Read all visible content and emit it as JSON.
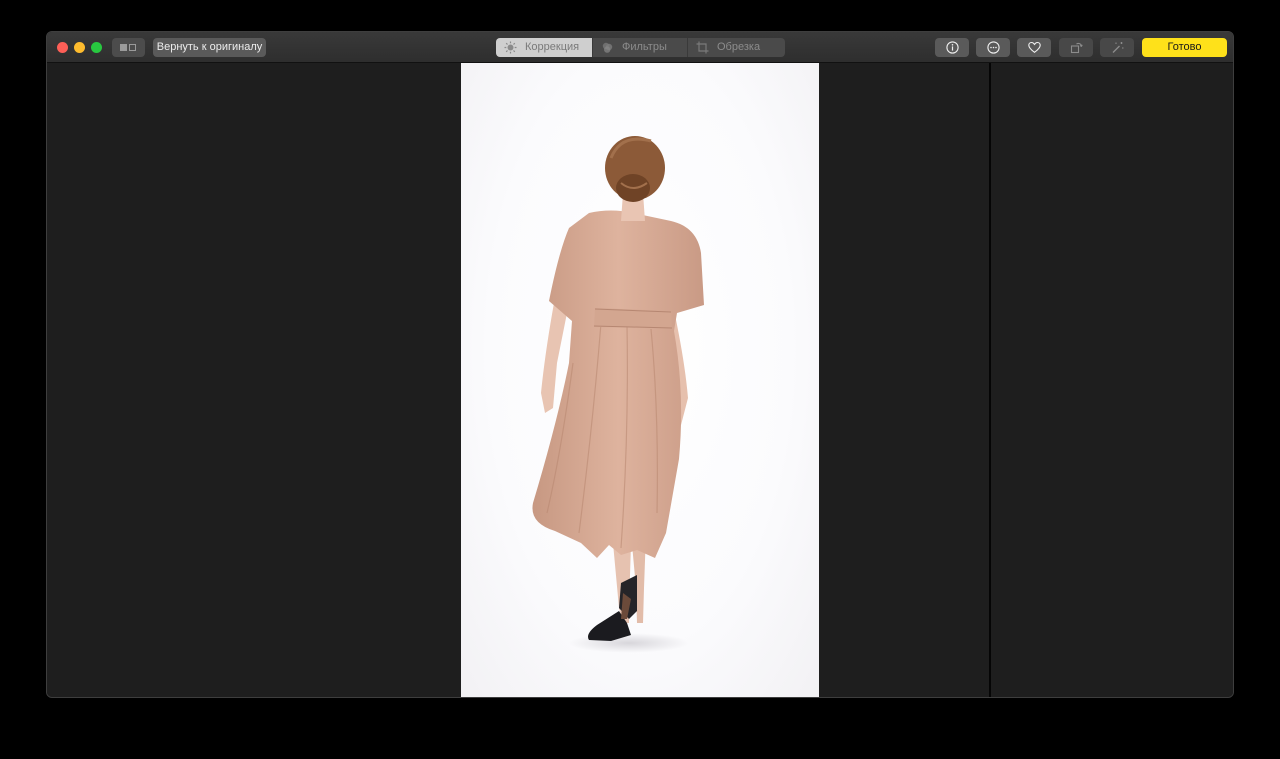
{
  "window": {
    "traffic_lights": [
      "close",
      "minimize",
      "zoom"
    ]
  },
  "toolbar": {
    "view_toggle_icon": "split-view-icon",
    "revert_label": "Вернуть к оригиналу",
    "tabs": [
      {
        "label": "Коррекция",
        "icon": "adjust-icon",
        "active": true
      },
      {
        "label": "Фильтры",
        "icon": "filters-icon",
        "active": false
      },
      {
        "label": "Обрезка",
        "icon": "crop-icon",
        "active": false
      }
    ],
    "icon_buttons": [
      "info-icon",
      "more-icon",
      "heart-icon",
      "rotate-icon",
      "magic-wand-icon"
    ],
    "done_label": "Готово"
  },
  "colors": {
    "window_bg": "#1e1e1e",
    "accent": "#fee11a",
    "close": "#fe5f57",
    "minimize": "#febc2e",
    "zoom": "#28c840"
  },
  "photo": {
    "subject": "woman in pink dress walking away on white background"
  }
}
